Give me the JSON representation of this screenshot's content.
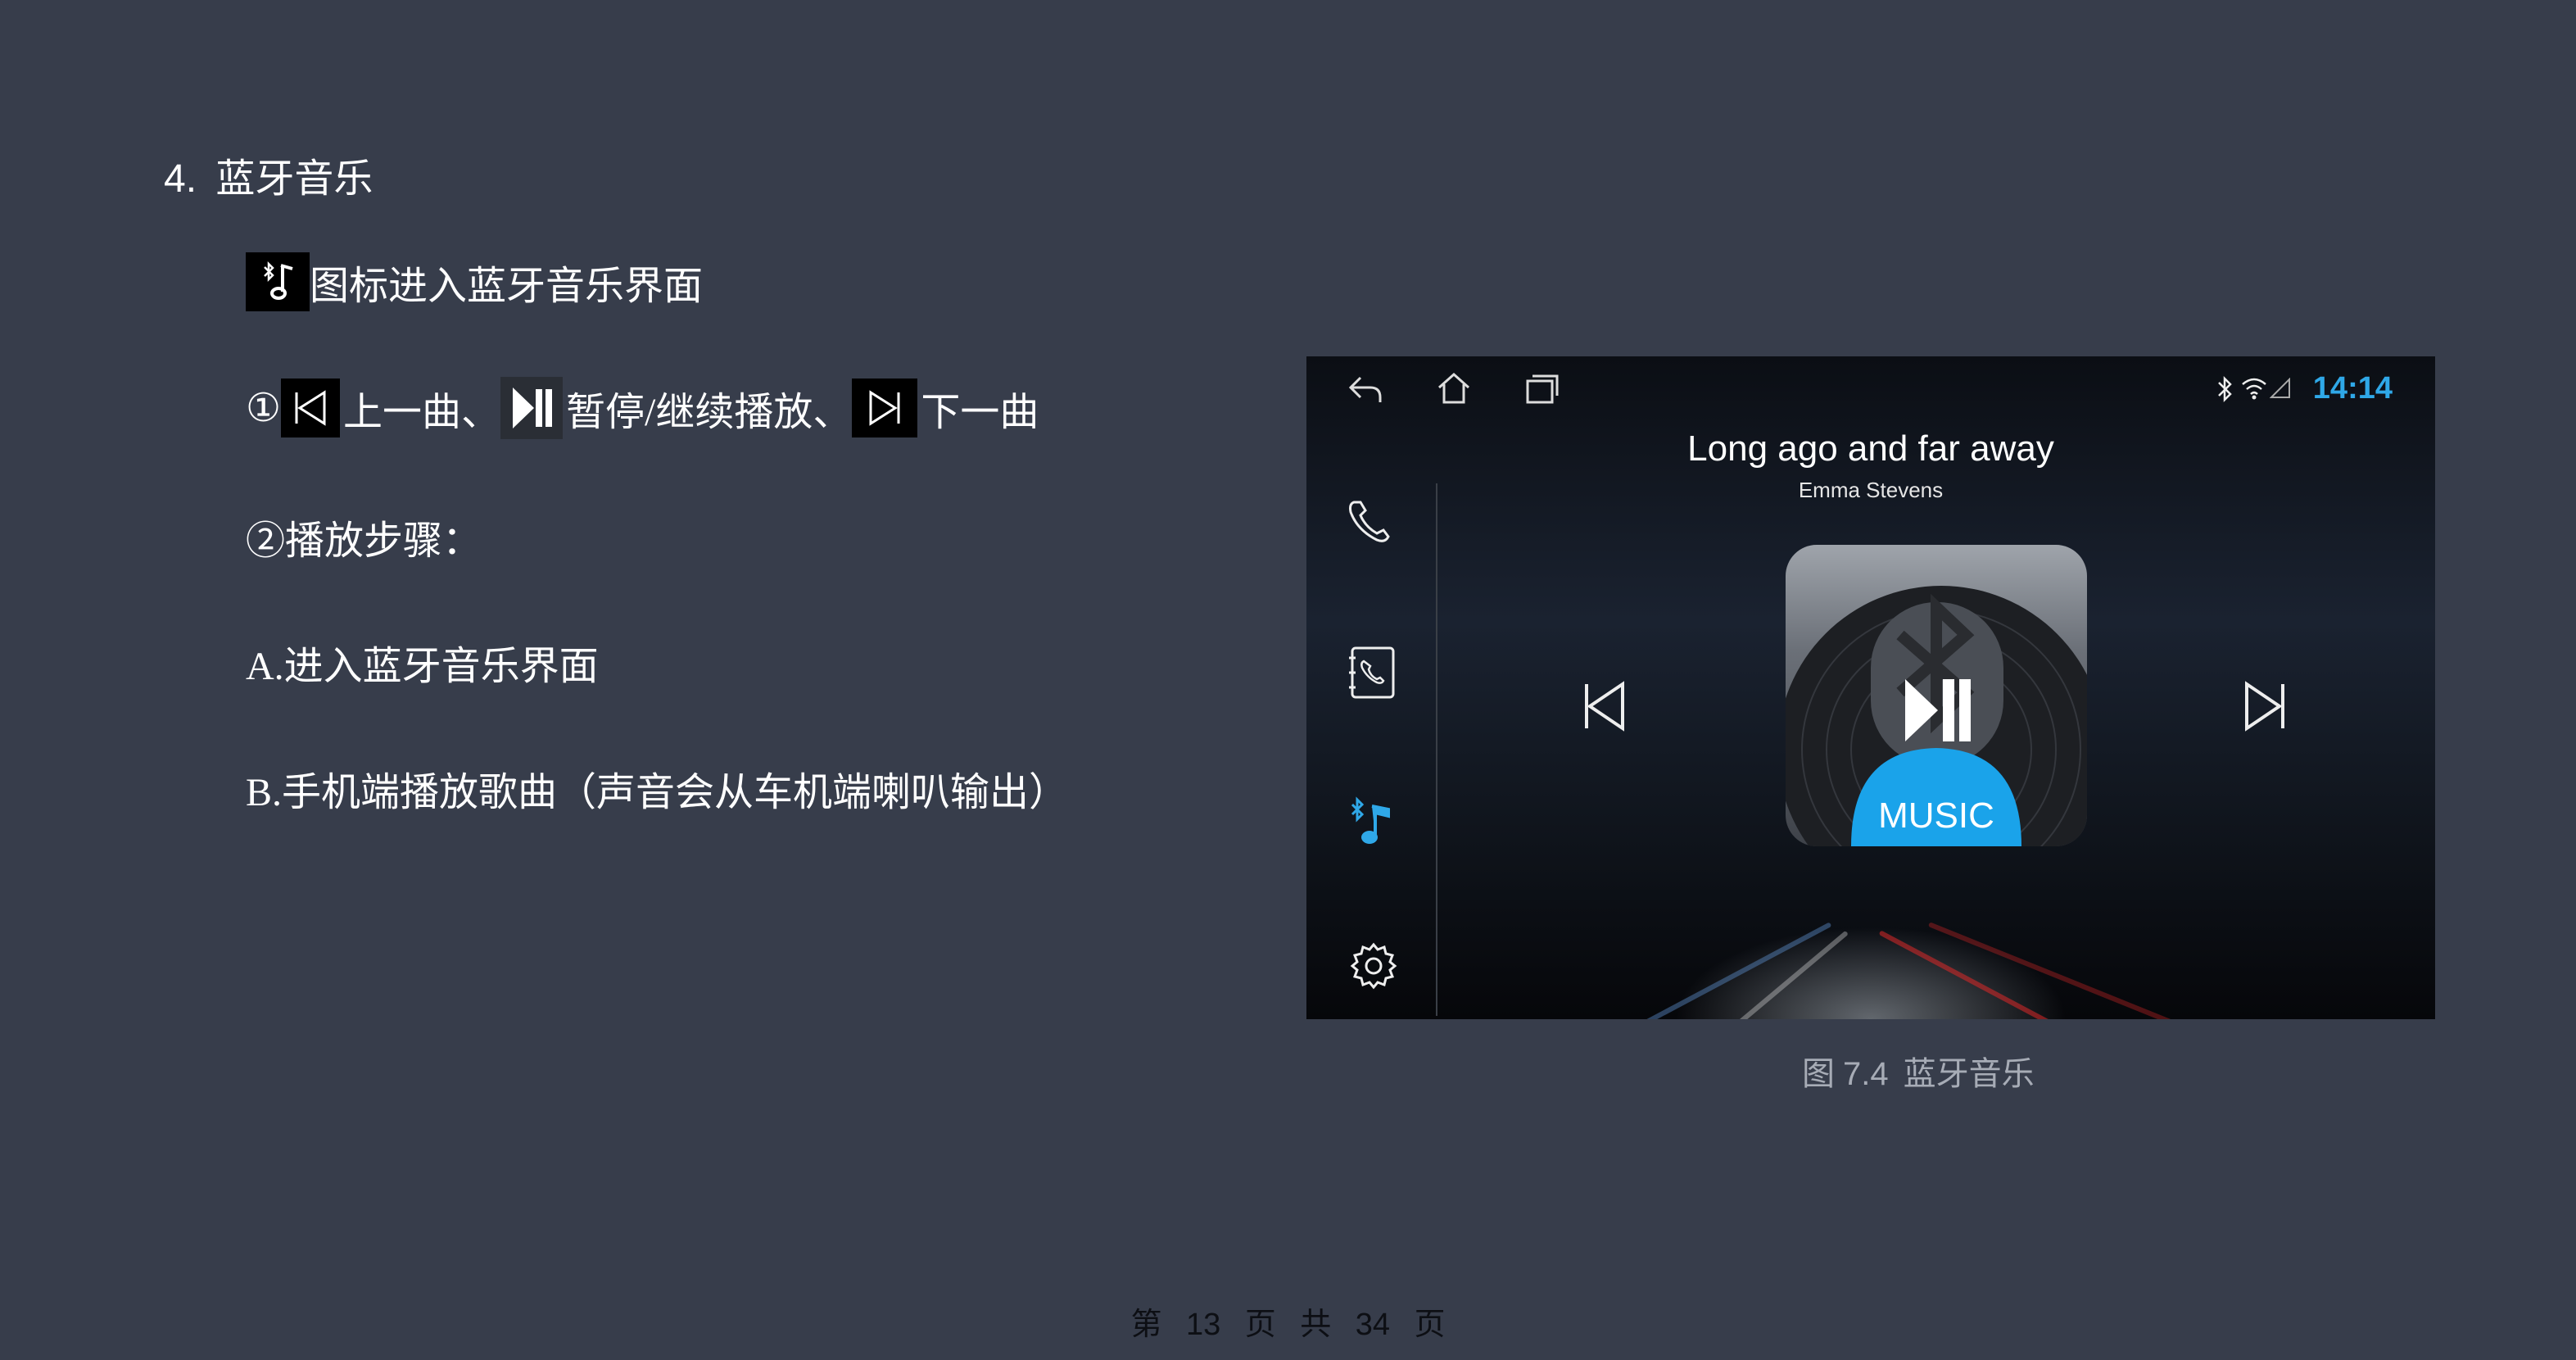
{
  "section": {
    "number": "4.",
    "title": "蓝牙音乐"
  },
  "intro": {
    "text": "图标进入蓝牙音乐界面"
  },
  "controls": {
    "prefix": "①",
    "prev_label": "上一曲、",
    "play_label": "暂停/继续播放、",
    "next_label": "下一曲"
  },
  "steps": {
    "heading": "②播放步骤：",
    "a": "A.进入蓝牙音乐界面",
    "b": "B.手机端播放歌曲（声音会从车机端喇叭输出）"
  },
  "screen": {
    "clock": "14:14",
    "song_title": "Long ago and far away",
    "artist": "Emma Stevens",
    "album_label": "MUSIC",
    "accent": "#2fa8e8"
  },
  "caption": {
    "figure": "图",
    "number": "7.4",
    "title": "蓝牙音乐"
  },
  "footer": {
    "page_prefix": "第",
    "page": "13",
    "page_mid": "页",
    "total_prefix": "共",
    "total": "34",
    "total_suffix": "页"
  }
}
